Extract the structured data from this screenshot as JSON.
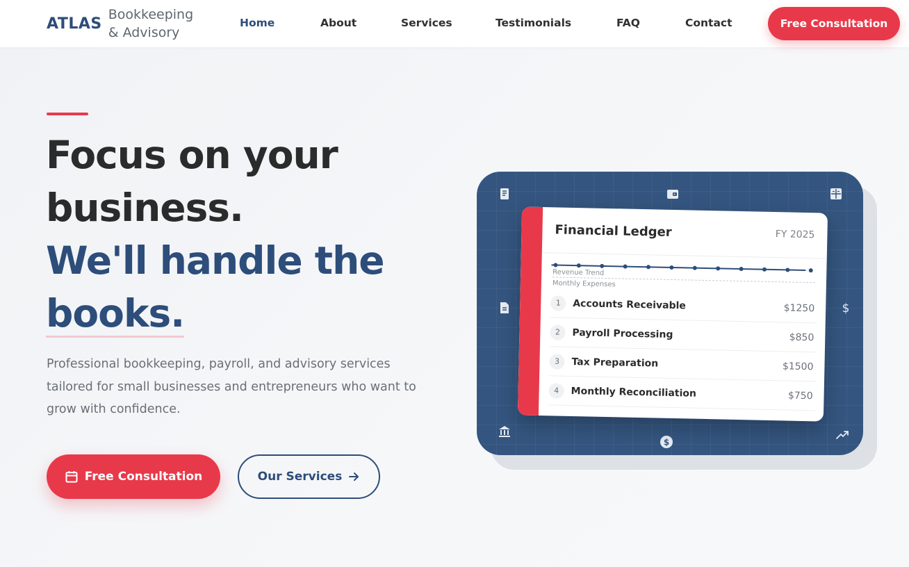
{
  "brand": {
    "name": "ATLAS",
    "sub_line1": "Bookkeeping",
    "sub_line2": "& Advisory"
  },
  "nav": {
    "links": [
      {
        "label": "Home",
        "active": true
      },
      {
        "label": "About"
      },
      {
        "label": "Services"
      },
      {
        "label": "Testimonials"
      },
      {
        "label": "FAQ"
      },
      {
        "label": "Contact"
      }
    ],
    "cta_label": "Free Consultation"
  },
  "hero": {
    "title_line1": "Focus on your",
    "title_line2": "business.",
    "title_line3": "We'll handle the",
    "title_line4": "books.",
    "description": "Professional bookkeeping, payroll, and advisory services tailored for small businesses and entrepreneurs who want to grow with confidence.",
    "primary_cta": "Free Consultation",
    "secondary_cta": "Our Services",
    "primary_icon": "calendar-icon",
    "secondary_icon": "arrow-right-icon"
  },
  "ledger": {
    "title": "Financial Ledger",
    "fiscal_year": "FY 2025",
    "trend_label": "Revenue Trend",
    "expenses_label": "Monthly Expenses",
    "rows": [
      {
        "num": "1",
        "name": "Accounts Receivable",
        "amount": "$1250"
      },
      {
        "num": "2",
        "name": "Payroll Processing",
        "amount": "$850"
      },
      {
        "num": "3",
        "name": "Tax Preparation",
        "amount": "$1500"
      },
      {
        "num": "4",
        "name": "Monthly Reconciliation",
        "amount": "$750"
      }
    ]
  },
  "panel_icons": [
    "receipt-icon",
    "wallet-icon",
    "calculator-icon",
    "document-icon",
    "dollar-icon",
    "bank-icon",
    "coin-icon",
    "trending-up-icon"
  ],
  "colors": {
    "navy": "#2d4d7a",
    "red": "#e8394a",
    "panel": "#34557f"
  }
}
